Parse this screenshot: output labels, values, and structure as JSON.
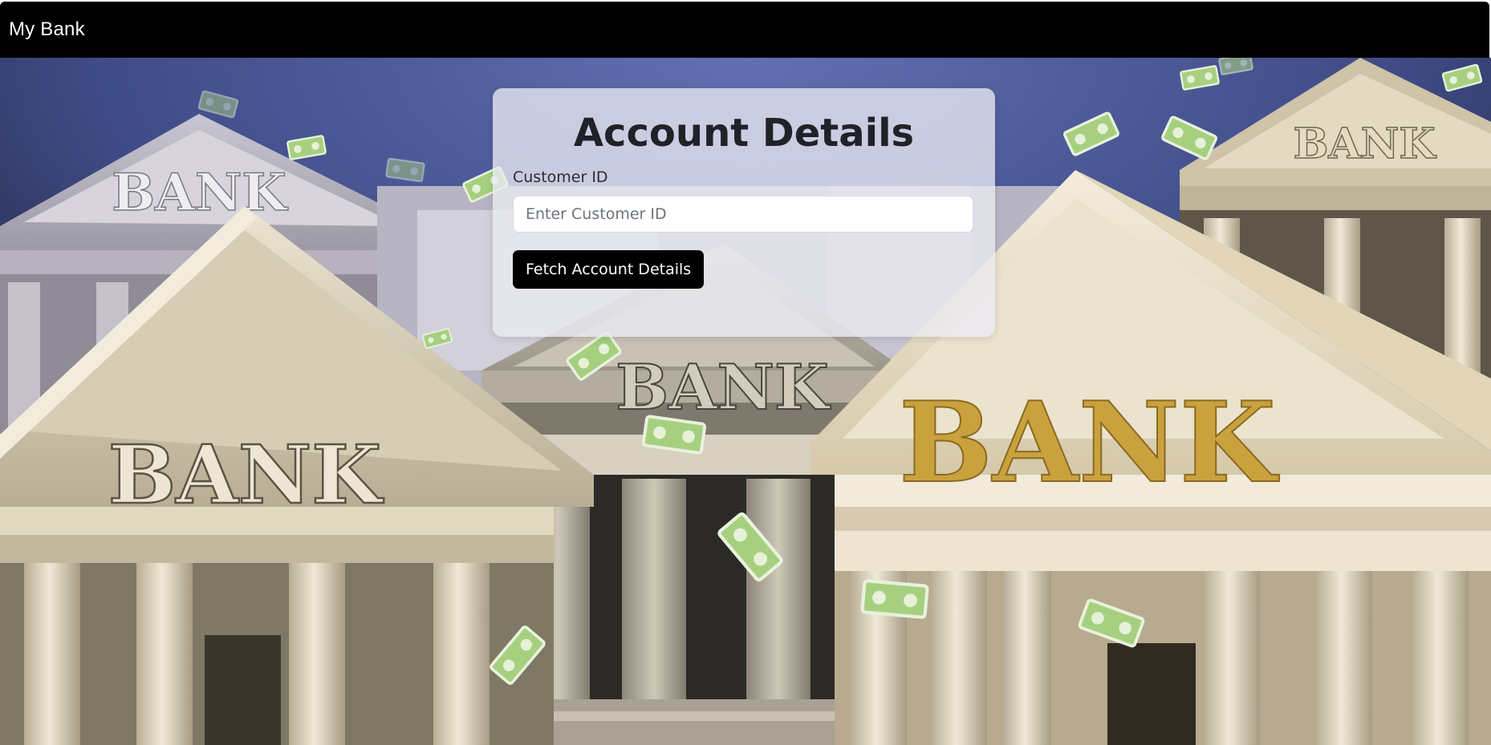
{
  "navbar": {
    "brand": "My Bank"
  },
  "hero": {
    "background_image": "bank-buildings-with-flying-money",
    "sign_texts": [
      "BANK",
      "BANK",
      "BANK",
      "BANK",
      "BANK"
    ]
  },
  "card": {
    "title": "Account Details",
    "customer_id_label": "Customer ID",
    "customer_id_value": "",
    "customer_id_placeholder": "Enter Customer ID",
    "fetch_button_label": "Fetch Account Details"
  },
  "colors": {
    "navbar_bg": "#000000",
    "button_bg": "#000000",
    "button_text": "#ffffff",
    "sky": "#4a5b9c",
    "stone": "#d9cfb8",
    "gold": "#c9a23e",
    "money": "#8fc46a"
  }
}
